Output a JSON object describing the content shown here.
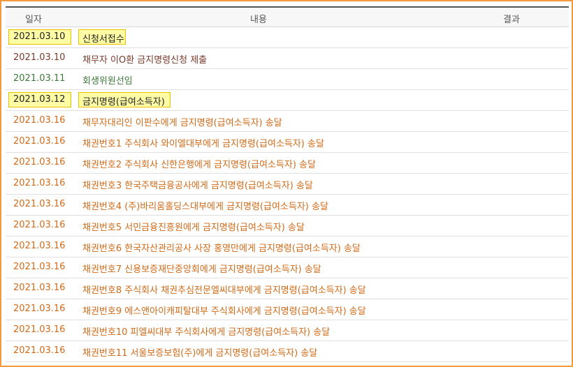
{
  "table": {
    "headers": {
      "date": "일자",
      "content": "내용",
      "result": "결과"
    },
    "rows": [
      {
        "date": "2021.03.10",
        "content": "신청서접수",
        "color": "#222222",
        "highlighted": true
      },
      {
        "date": "2021.03.10",
        "content": "채무자 이O환 금지명령신청 제출",
        "color": "#7a3a2a",
        "highlighted": false
      },
      {
        "date": "2021.03.11",
        "content": "회생위원선임",
        "color": "#3d7a3a",
        "highlighted": false
      },
      {
        "date": "2021.03.12",
        "content": "금지명령(급여소득자)",
        "color": "#222222",
        "highlighted": true
      },
      {
        "date": "2021.03.16",
        "content": "채무자대리인 이판수에게 금지명령(급여소득자) 송달",
        "color": "#d06a18",
        "highlighted": false
      },
      {
        "date": "2021.03.16",
        "content": "채권번호1 주식회사 와이엘대부에게 금지명령(급여소득자) 송달",
        "color": "#d06a18",
        "highlighted": false
      },
      {
        "date": "2021.03.16",
        "content": "채권번호2 주식회사 신한은행에게 금지명령(급여소득자) 송달",
        "color": "#d06a18",
        "highlighted": false
      },
      {
        "date": "2021.03.16",
        "content": "채권번호3 한국주택금융공사에게 금지명령(급여소득자) 송달",
        "color": "#d06a18",
        "highlighted": false
      },
      {
        "date": "2021.03.16",
        "content": "채권번호4 (주)바리움홀딩스대부에게 금지명령(급여소득자) 송달",
        "color": "#d06a18",
        "highlighted": false
      },
      {
        "date": "2021.03.16",
        "content": "채권번호5 서민금융진흥원에게 금지명령(급여소득자) 송달",
        "color": "#d06a18",
        "highlighted": false
      },
      {
        "date": "2021.03.16",
        "content": "채권번호6 한국자산관리공사 사장 홍영만에게 금지명령(급여소득자) 송달",
        "color": "#d06a18",
        "highlighted": false
      },
      {
        "date": "2021.03.16",
        "content": "채권번호7 신용보증재단중앙회에게 금지명령(급여소득자) 송달",
        "color": "#d06a18",
        "highlighted": false
      },
      {
        "date": "2021.03.16",
        "content": "채권번호8 주식회사 채권추심전문엘씨대부에게 금지명령(급여소득자) 송달",
        "color": "#d06a18",
        "highlighted": false
      },
      {
        "date": "2021.03.16",
        "content": "채권번호9 에스앤아이캐피탈대부 주식회사에게 금지명령(급여소득자) 송달",
        "color": "#d06a18",
        "highlighted": false
      },
      {
        "date": "2021.03.16",
        "content": "채권번호10 피엘씨대부 주식회사에게 금지명령(급여소득자) 송달",
        "color": "#d06a18",
        "highlighted": false
      },
      {
        "date": "2021.03.16",
        "content": "채권번호11 서울보증보험(주)에게 금지명령(급여소득자) 송달",
        "color": "#d06a18",
        "highlighted": false
      }
    ]
  }
}
